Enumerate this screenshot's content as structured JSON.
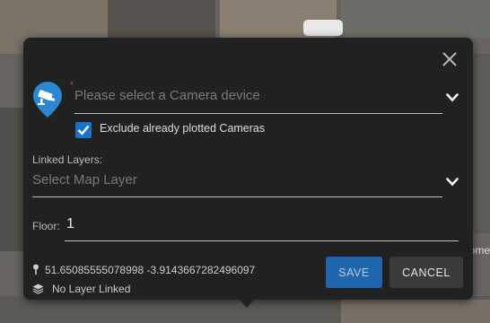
{
  "camera_select": {
    "placeholder": "Please select a Camera device",
    "required_marker": "*"
  },
  "exclude_plotted": {
    "checked": true,
    "label": "Exclude already plotted Cameras"
  },
  "linked_layers": {
    "label": "Linked Layers:",
    "placeholder": "Select Map Layer"
  },
  "floor": {
    "label": "Floor:",
    "value": "1"
  },
  "location": {
    "coordinates": "51.65085555078998 -3.9143667282496097"
  },
  "layer_status": {
    "text": "No Layer Linked"
  },
  "buttons": {
    "save": "SAVE",
    "cancel": "CANCEL"
  },
  "map": {
    "partial_label": "ome"
  },
  "colors": {
    "panel_bg": "#212121",
    "accent": "#1a73c9",
    "required": "#e34a4a"
  },
  "icons": {
    "close": "close-icon",
    "camera_marker": "camera-marker-icon",
    "dropdown": "chevron-down-icon",
    "checkbox": "checkmark-icon",
    "pin": "pin-icon",
    "layers": "layers-icon"
  }
}
